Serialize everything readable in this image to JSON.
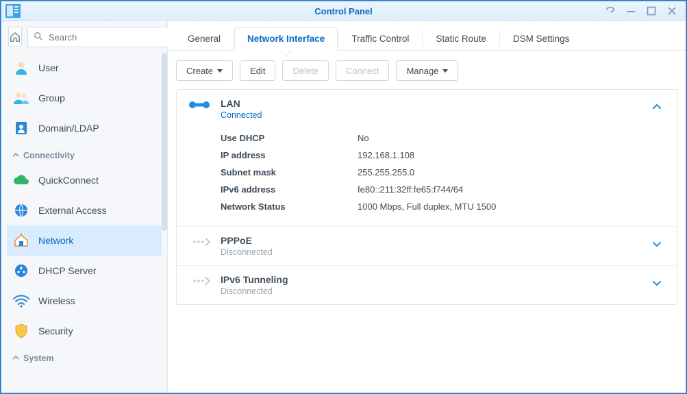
{
  "window": {
    "title": "Control Panel"
  },
  "search": {
    "placeholder": "Search"
  },
  "sidebar": {
    "items": [
      {
        "label": "User"
      },
      {
        "label": "Group"
      },
      {
        "label": "Domain/LDAP"
      }
    ],
    "section1": "Connectivity",
    "conn": [
      {
        "label": "QuickConnect"
      },
      {
        "label": "External Access"
      },
      {
        "label": "Network"
      },
      {
        "label": "DHCP Server"
      },
      {
        "label": "Wireless"
      },
      {
        "label": "Security"
      }
    ],
    "section2": "System"
  },
  "tabs": {
    "general": "General",
    "nif": "Network Interface",
    "traffic": "Traffic Control",
    "route": "Static Route",
    "dsm": "DSM Settings"
  },
  "toolbar": {
    "create": "Create",
    "edit": "Edit",
    "delete": "Delete",
    "connect": "Connect",
    "manage": "Manage"
  },
  "ifaces": {
    "lan": {
      "name": "LAN",
      "status": "Connected",
      "rows": {
        "dhcp_l": "Use DHCP",
        "dhcp_v": "No",
        "ip_l": "IP address",
        "ip_v": "192.168.1.108",
        "mask_l": "Subnet mask",
        "mask_v": "255.255.255.0",
        "v6_l": "IPv6 address",
        "v6_v": "fe80::211:32ff:fe65:f744/64",
        "ns_l": "Network Status",
        "ns_v": "1000 Mbps, Full duplex, MTU 1500"
      }
    },
    "pppoe": {
      "name": "PPPoE",
      "status": "Disconnected"
    },
    "v6t": {
      "name": "IPv6 Tunneling",
      "status": "Disconnected"
    }
  }
}
